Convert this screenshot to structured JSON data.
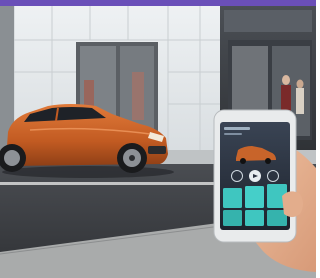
{
  "scene": {
    "subject": "photo-street-car-smartphone-remote-app",
    "colors": {
      "top_band": "#6a4fb8",
      "car_body": "#c8642a",
      "phone_screen_bg": "#2a3240",
      "app_tile": "#3fc6c0"
    },
    "phone_app": {
      "icons": [
        "lock-icon",
        "unlock-icon",
        "power-icon"
      ]
    }
  }
}
